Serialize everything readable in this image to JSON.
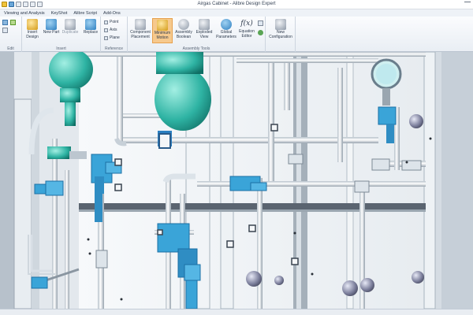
{
  "window": {
    "title": "Airgas Cabinet - Alibre Design Expert"
  },
  "tabs": [
    {
      "label": "Viewing and Analysis"
    },
    {
      "label": "KeyShot"
    },
    {
      "label": "Alibre Script"
    },
    {
      "label": "Add-Ons"
    }
  ],
  "ribbon": {
    "groups": [
      {
        "label": "Edit"
      },
      {
        "label": "Insert"
      },
      {
        "label": "Reference"
      },
      {
        "label": "Assembly Tools"
      }
    ],
    "insert_design": "Insert Design",
    "new_part": "New Part",
    "duplicate": "Duplicate",
    "replace": "Replace",
    "point": "Point",
    "axis": "Axis",
    "plane": "Plane",
    "component_placement": "Component Placement",
    "minimum_motion": "Minimum Motion",
    "assembly_boolean": "Assembly Boolean",
    "exploded_view": "Exploded View",
    "global_parameters": "Global Parameters",
    "equation_editor": "Equation Editor",
    "equation_symbol": "f(x)",
    "new_configuration": "New Configuration"
  },
  "colors": {
    "pipe": "#e9eef2",
    "pipe_shadow": "#9aa6b0",
    "fitting_blue": "#3aa4d8",
    "regulator_teal": "#2eb3a3",
    "panel": "#f4f6f8",
    "ribbon_active": "#f6c98d"
  }
}
